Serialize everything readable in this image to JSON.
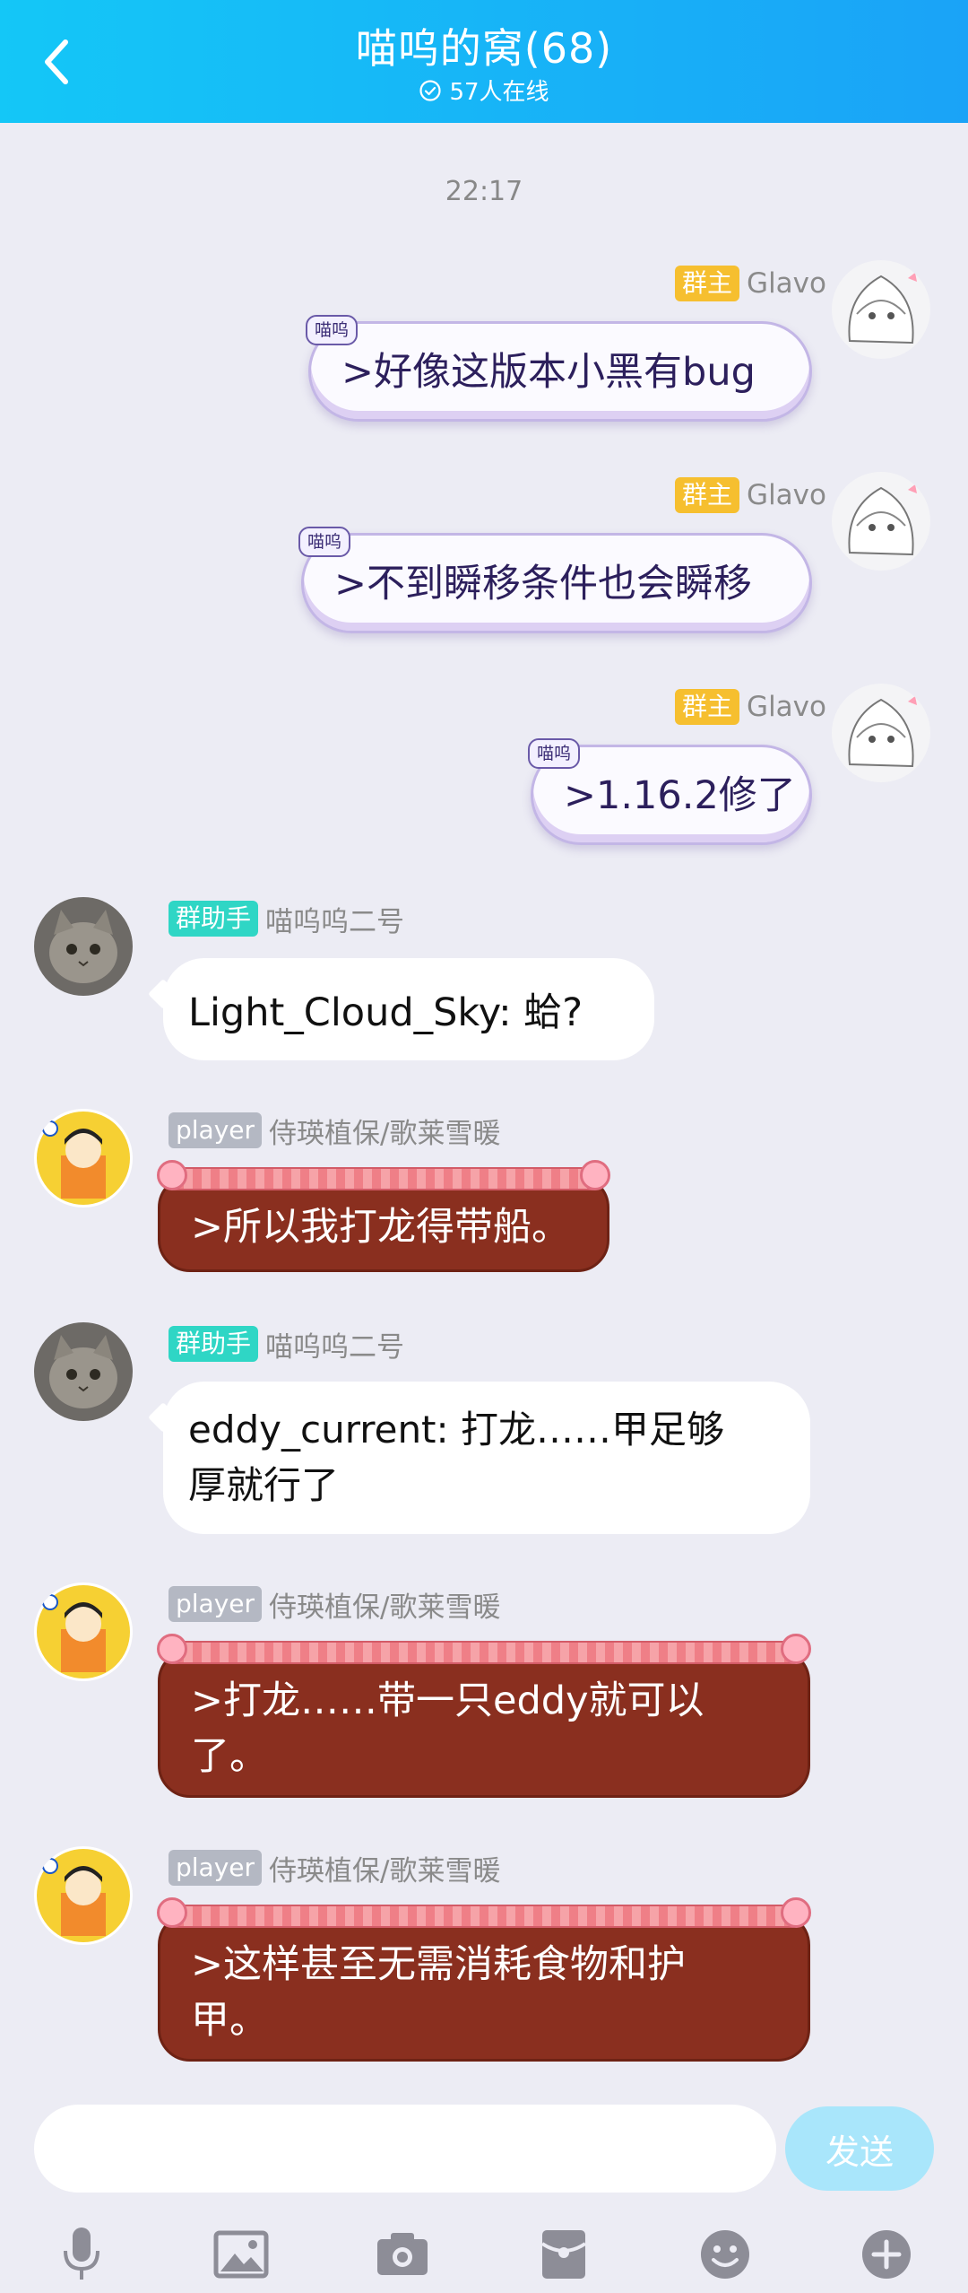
{
  "header": {
    "title": "喵呜的窝(68)",
    "online": "57人在线"
  },
  "chat": {
    "timestamp": "22:17",
    "messages": [
      {
        "sender": "Glavo",
        "role": "群主",
        "tag": "喵呜",
        "text": ">好像这版本小黑有bug"
      },
      {
        "sender": "Glavo",
        "role": "群主",
        "tag": "喵呜",
        "text": ">不到瞬移条件也会瞬移"
      },
      {
        "sender": "Glavo",
        "role": "群主",
        "tag": "喵呜",
        "text": ">1.16.2修了"
      },
      {
        "sender": "喵呜呜二号",
        "role": "群助手",
        "text": "Light_Cloud_Sky: 蛤?"
      },
      {
        "sender": "侍瑛植保/歌莱雪暖",
        "role": "player",
        "text": ">所以我打龙得带船。"
      },
      {
        "sender": "喵呜呜二号",
        "role": "群助手",
        "text_line1": "eddy_current: 打龙……甲足够",
        "text_line2": "厚就行了"
      },
      {
        "sender": "侍瑛植保/歌莱雪暖",
        "role": "player",
        "text_line1": ">打龙……带一只eddy就可以",
        "text_line2": "了。"
      },
      {
        "sender": "侍瑛植保/歌莱雪暖",
        "role": "player",
        "text_line1": ">这样甚至无需消耗食物和护",
        "text_line2": "甲。"
      }
    ]
  },
  "input": {
    "placeholder": "",
    "send_label": "发送"
  },
  "toolbar": {
    "icons": [
      "microphone-icon",
      "image-icon",
      "camera-icon",
      "red-packet-icon",
      "emoji-icon",
      "plus-icon"
    ]
  },
  "colors": {
    "header": "#14c7f7",
    "send_button": "#a9e6fb",
    "badge_owner": "#f6bf2f",
    "badge_helper": "#2fd6c5",
    "badge_player": "#b4b8c3",
    "player_bubble": "#8a2f1f"
  }
}
